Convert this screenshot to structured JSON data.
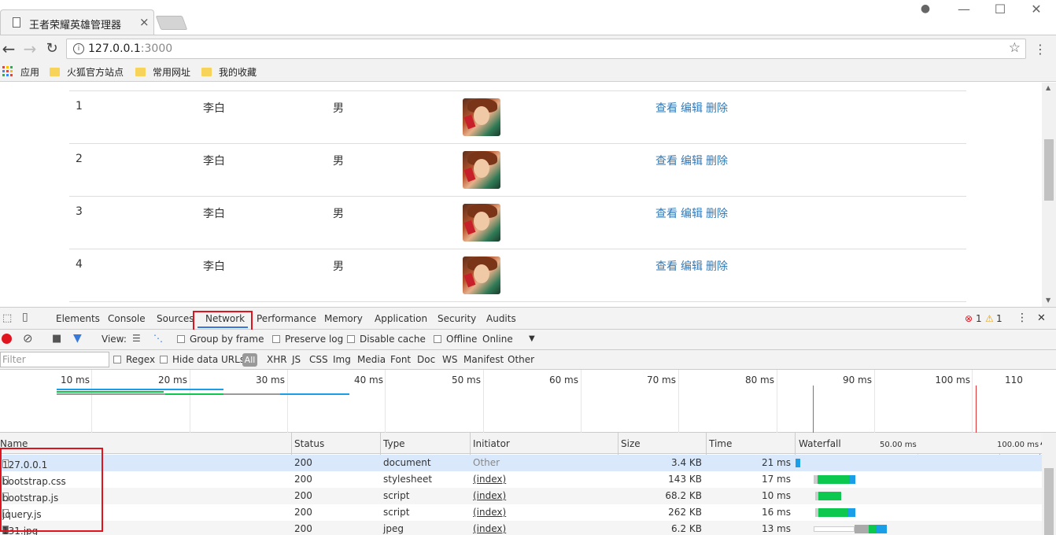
{
  "browser": {
    "tab_title": "王者荣耀英雄管理器",
    "tab_close": "×",
    "url_host": "127.0.0.1",
    "url_port": ":3000",
    "info_glyph": "i",
    "star_glyph": "☆",
    "menu_glyph": "⋮",
    "back_glyph": "←",
    "forward_glyph": "→",
    "reload_glyph": "↻",
    "min_glyph": "—",
    "max_glyph": "☐",
    "close_glyph": "✕",
    "account_glyph": "●",
    "bookmarks": [
      {
        "label": "应用",
        "icon": "apps-grid-icon"
      },
      {
        "label": "火狐官方站点",
        "icon": "folder-icon"
      },
      {
        "label": "常用网址",
        "icon": "folder-icon"
      },
      {
        "label": "我的收藏",
        "icon": "folder-icon"
      }
    ]
  },
  "heroes": {
    "rows": [
      {
        "id": "1",
        "name": "李白",
        "gender": "男"
      },
      {
        "id": "2",
        "name": "李白",
        "gender": "男"
      },
      {
        "id": "3",
        "name": "李白",
        "gender": "男"
      },
      {
        "id": "4",
        "name": "李白",
        "gender": "男"
      }
    ],
    "actions": {
      "view": "查看",
      "edit": "编辑",
      "delete": "删除"
    }
  },
  "devtools": {
    "tabs": [
      "Elements",
      "Console",
      "Sources",
      "Network",
      "Performance",
      "Memory",
      "Application",
      "Security",
      "Audits"
    ],
    "active_tab": "Network",
    "error_count": "1",
    "warning_count": "1",
    "more_glyph": "⋮",
    "close_glyph": "✕",
    "toolbar": {
      "view_label": "View:",
      "group_by_frame": "Group by frame",
      "preserve_log": "Preserve log",
      "disable_cache": "Disable cache",
      "offline": "Offline",
      "throttle": "Online",
      "throttle_caret": "▼"
    },
    "filter": {
      "placeholder": "Filter",
      "regex": "Regex",
      "hide_data_urls": "Hide data URLs",
      "all": "All",
      "types": [
        "XHR",
        "JS",
        "CSS",
        "Img",
        "Media",
        "Font",
        "Doc",
        "WS",
        "Manifest",
        "Other"
      ]
    },
    "overview_ticks": [
      "10 ms",
      "20 ms",
      "30 ms",
      "40 ms",
      "50 ms",
      "60 ms",
      "70 ms",
      "80 ms",
      "90 ms",
      "100 ms",
      "110"
    ],
    "columns": {
      "name": "Name",
      "status": "Status",
      "type": "Type",
      "initiator": "Initiator",
      "size": "Size",
      "time": "Time",
      "waterfall": "Waterfall",
      "wf_tick1": "50.00 ms",
      "wf_tick2": "100.00 ms",
      "sort_glyph": "▲"
    },
    "requests": [
      {
        "name": "127.0.0.1",
        "status": "200",
        "type": "document",
        "initiator": "Other",
        "size": "3.4 KB",
        "time": "21 ms"
      },
      {
        "name": "bootstrap.css",
        "status": "200",
        "type": "stylesheet",
        "initiator": "(index)",
        "size": "143 KB",
        "time": "17 ms"
      },
      {
        "name": "bootstrap.js",
        "status": "200",
        "type": "script",
        "initiator": "(index)",
        "size": "68.2 KB",
        "time": "10 ms"
      },
      {
        "name": "jquery.js",
        "status": "200",
        "type": "script",
        "initiator": "(index)",
        "size": "262 KB",
        "time": "16 ms"
      },
      {
        "name": "131.jpg",
        "status": "200",
        "type": "jpeg",
        "initiator": "(index)",
        "size": "6.2 KB",
        "time": "13 ms"
      }
    ]
  }
}
